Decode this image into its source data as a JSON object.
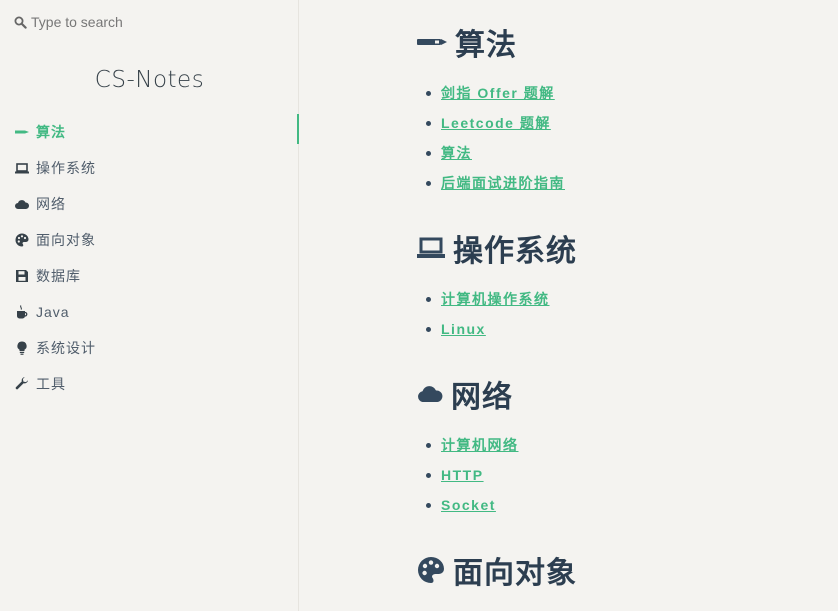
{
  "search": {
    "placeholder": "Type to search",
    "icon": "search-icon"
  },
  "app_name": "CS-Notes",
  "sidebar": {
    "items": [
      {
        "label": "算法",
        "icon": "pen-icon",
        "active": true
      },
      {
        "label": "操作系统",
        "icon": "laptop-icon"
      },
      {
        "label": "网络",
        "icon": "cloud-icon"
      },
      {
        "label": "面向对象",
        "icon": "palette-icon"
      },
      {
        "label": "数据库",
        "icon": "floppy-disk-icon"
      },
      {
        "label": "Java",
        "icon": "coffee-icon"
      },
      {
        "label": "系统设计",
        "icon": "lightbulb-icon"
      },
      {
        "label": "工具",
        "icon": "wrench-icon"
      }
    ]
  },
  "main": {
    "sections": [
      {
        "title": "算法",
        "icon": "pen-icon",
        "links": [
          "剑指 Offer 题解",
          "Leetcode 题解",
          "算法",
          "后端面试进阶指南"
        ]
      },
      {
        "title": "操作系统",
        "icon": "laptop-icon",
        "links": [
          "计算机操作系统",
          "Linux"
        ]
      },
      {
        "title": "网络",
        "icon": "cloud-icon",
        "links": [
          "计算机网络",
          "HTTP",
          "Socket"
        ]
      },
      {
        "title": "面向对象",
        "icon": "palette-icon",
        "links": []
      }
    ]
  },
  "colors": {
    "accent": "#42b983",
    "text": "#34495e",
    "heading": "#2c3e50",
    "background": "#f4f3f0"
  }
}
